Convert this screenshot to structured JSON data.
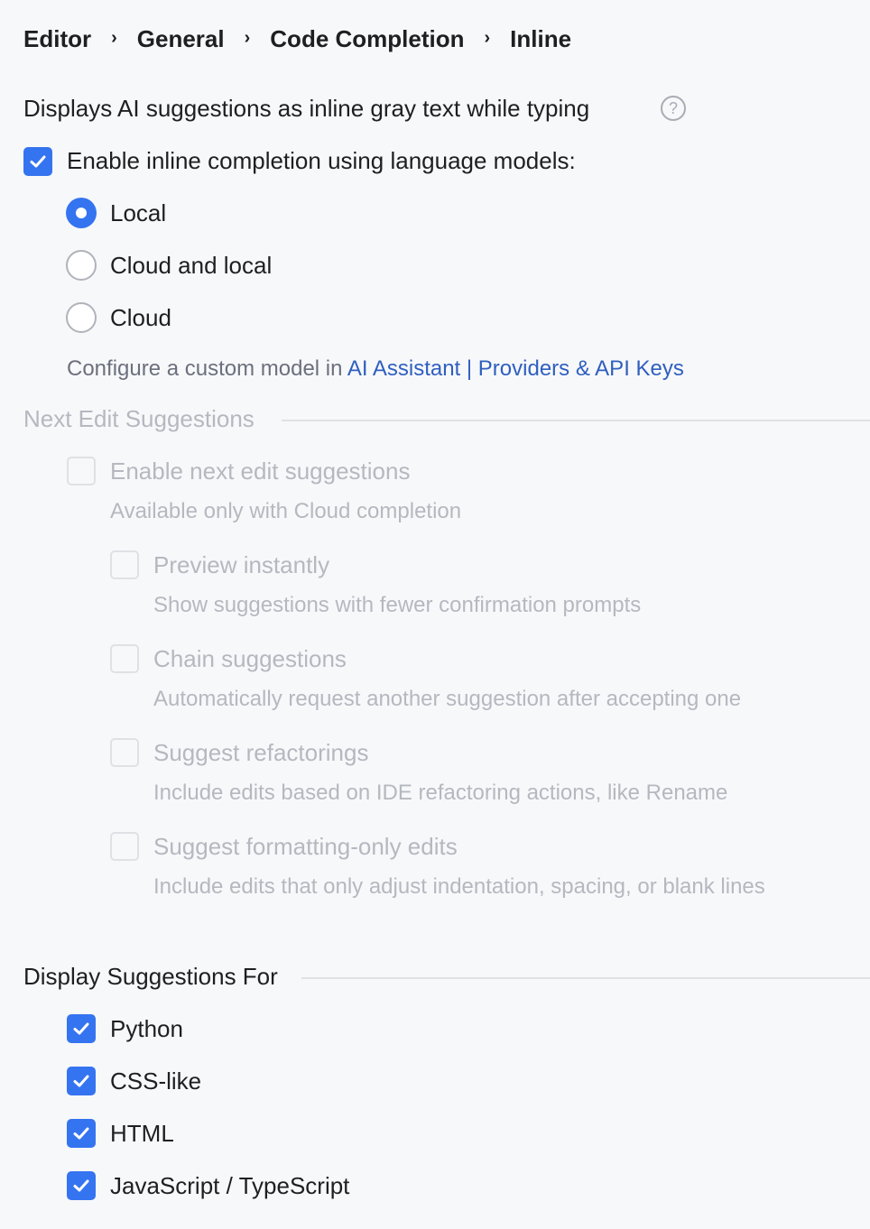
{
  "breadcrumb": [
    "Editor",
    "General",
    "Code Completion",
    "Inline"
  ],
  "breadcrumb_separator": "›",
  "description": "Displays AI suggestions as inline gray text while typing",
  "help_icon": "?",
  "inline_completion": {
    "label": "Enable inline completion using language models:",
    "checked": true,
    "options": [
      {
        "label": "Local",
        "selected": true
      },
      {
        "label": "Cloud and local",
        "selected": false
      },
      {
        "label": "Cloud",
        "selected": false
      }
    ],
    "configure_text": "Configure a custom model in ",
    "configure_link": "AI Assistant | Providers & API Keys"
  },
  "next_edit": {
    "section_title": "Next Edit Suggestions",
    "enable_label": "Enable next edit suggestions",
    "enable_hint": "Available only with Cloud completion",
    "options": [
      {
        "label": "Preview instantly",
        "hint": "Show suggestions with fewer confirmation prompts"
      },
      {
        "label": "Chain suggestions",
        "hint": "Automatically request another suggestion after accepting one"
      },
      {
        "label": "Suggest refactorings",
        "hint": "Include edits based on IDE refactoring actions, like Rename"
      },
      {
        "label": "Suggest formatting-only edits",
        "hint": "Include edits that only adjust indentation, spacing, or blank lines"
      }
    ]
  },
  "display_for": {
    "section_title": "Display Suggestions For",
    "languages": [
      "Python",
      "CSS-like",
      "HTML",
      "JavaScript / TypeScript"
    ]
  },
  "colors": {
    "accent": "#3574f0",
    "link": "#2f5fbf",
    "disabled_text": "#b5b8bf",
    "background": "#f7f8fa"
  }
}
